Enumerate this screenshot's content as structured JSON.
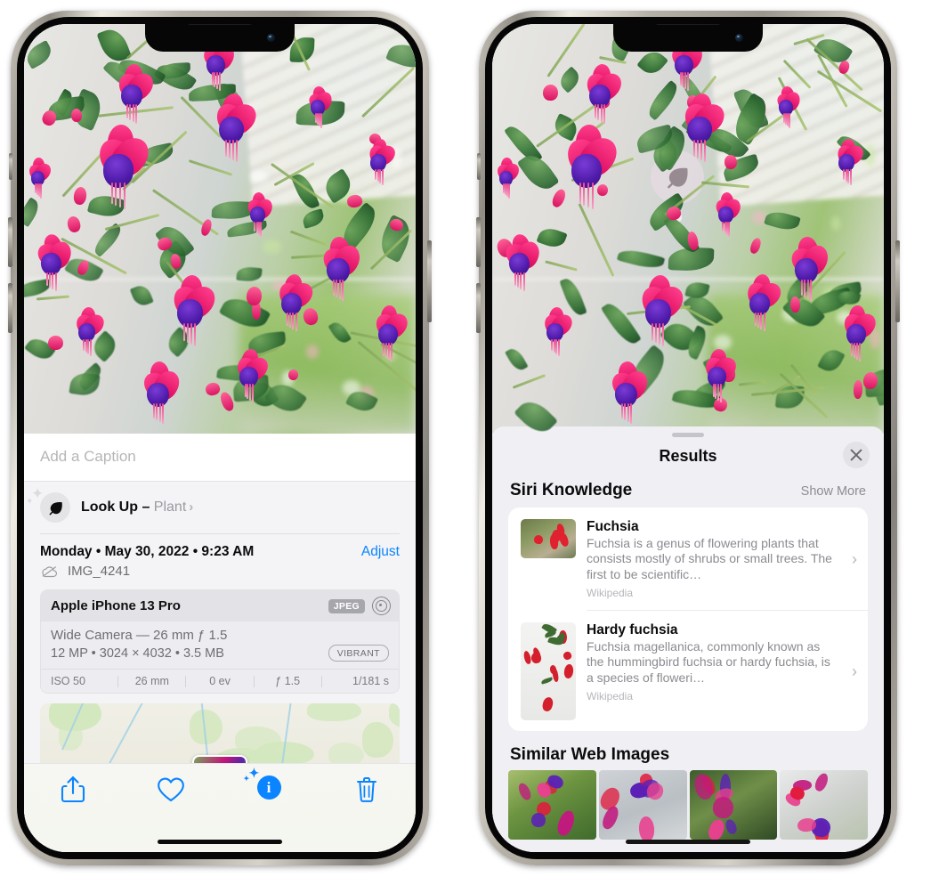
{
  "left_phone": {
    "name": "iPhone photo detail view",
    "caption_field": {
      "placeholder": "Add a Caption",
      "value": ""
    },
    "lookup": {
      "label": "Look Up –",
      "subject": "Plant",
      "chevron": "›",
      "icon": "leaf-icon"
    },
    "date_row": {
      "date": "Monday • May 30, 2022 • 9:23 AM",
      "adjust_label": "Adjust"
    },
    "file_row": {
      "icon": "cloud-slash-icon",
      "filename": "IMG_4241"
    },
    "camera_card": {
      "device": "Apple iPhone 13 Pro",
      "format_badge": "JPEG",
      "raw_icon": "raw-circle-icon",
      "lens_line": "Wide Camera — 26 mm ƒ 1.5",
      "specs_line": "12 MP • 3024 × 4032 • 3.5 MB",
      "style_badge": "VIBRANT",
      "exif": [
        "ISO 50",
        "26 mm",
        "0 ev",
        "ƒ 1.5",
        "1/181 s"
      ]
    },
    "toolbar": [
      {
        "name": "share-button",
        "icon": "share-icon"
      },
      {
        "name": "favorite-button",
        "icon": "heart-icon"
      },
      {
        "name": "info-button",
        "icon": "info-sparkle-icon"
      },
      {
        "name": "delete-button",
        "icon": "trash-icon"
      }
    ],
    "accent_color": "#0a84ff"
  },
  "right_phone": {
    "name": "Visual Look Up results sheet",
    "marker": {
      "icon": "leaf-icon"
    },
    "sheet_title": "Results",
    "close_icon": "close-icon",
    "sections": [
      {
        "title": "Siri Knowledge",
        "action": "Show More",
        "items": [
          {
            "title": "Fuchsia",
            "description": "Fuchsia is a genus of flowering plants that consists mostly of shrubs or small trees. The first to be scientific…",
            "source": "Wikipedia",
            "thumbnail": "fuchsia-thumbnail",
            "chevron": "›"
          },
          {
            "title": "Hardy fuchsia",
            "description": "Fuchsia magellanica, commonly known as the hummingbird fuchsia or hardy fuchsia, is a species of floweri…",
            "source": "Wikipedia",
            "thumbnail": "hardy-fuchsia-thumbnail",
            "chevron": "›"
          }
        ]
      },
      {
        "title": "Similar Web Images",
        "tiles": [
          "similar-image-1",
          "similar-image-2",
          "similar-image-3",
          "similar-image-4"
        ]
      }
    ]
  }
}
